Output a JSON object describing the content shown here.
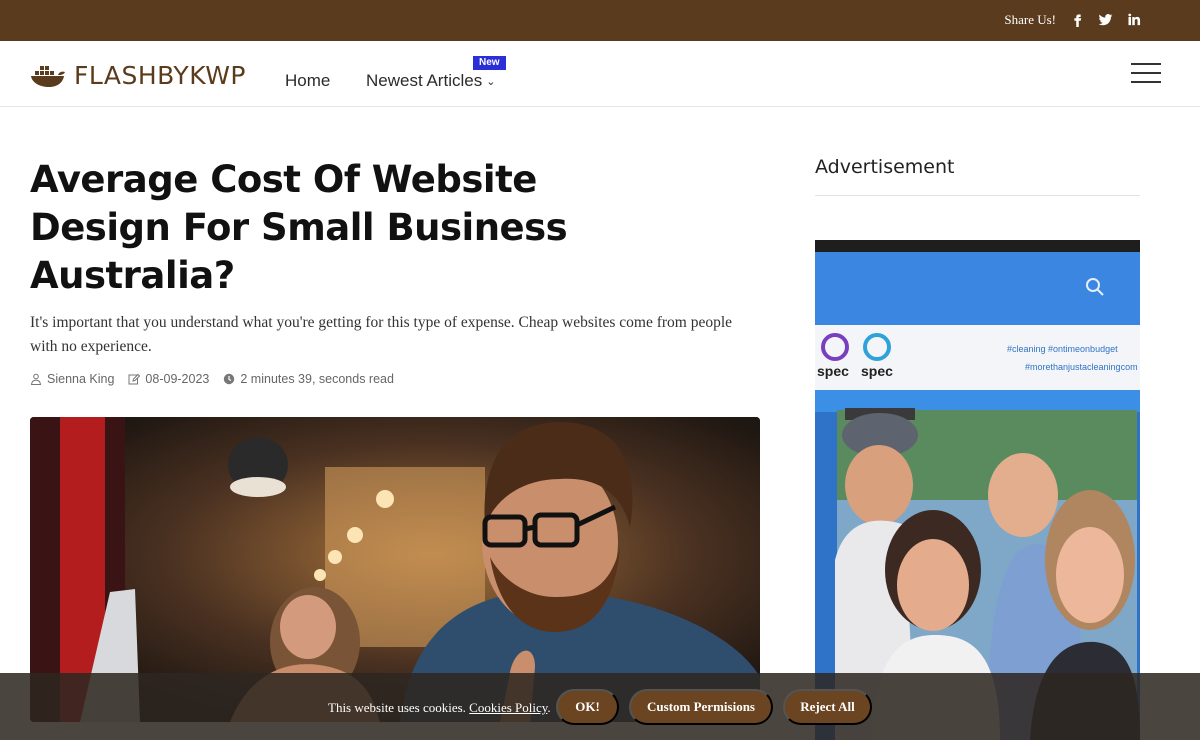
{
  "topbar": {
    "share_label": "Share Us!",
    "social_icons": [
      "facebook-icon",
      "twitter-icon",
      "linkedin-icon"
    ]
  },
  "header": {
    "logo_text": "FLASHBYKWP",
    "nav": {
      "home": "Home",
      "newest": "Newest Articles",
      "newest_badge": "New"
    }
  },
  "article": {
    "title": "Average Cost Of Website Design For Small Business Australia?",
    "subtitle": "It's important that you understand what you're getting for this type of expense. Cheap websites come from people with no experience.",
    "author": "Sienna King",
    "date": "08-09-2023",
    "read_time": "2 minutes 39, seconds read"
  },
  "sidebar": {
    "heading": "Advertisement",
    "ad_image_text": {
      "brand_1": "spec",
      "brand_2": "spec",
      "hashtags_1": "#cleaning  #ontimeonbudget",
      "hashtags_2": "#morethanjustacleaningcom"
    }
  },
  "cookie_bar": {
    "text": "This website uses cookies.",
    "link": "Cookies Policy",
    "suffix": ".",
    "ok": "OK!",
    "custom": "Custom Permisions",
    "reject": "Reject All"
  },
  "colors": {
    "brand_brown": "#5b3b1d",
    "button_brown": "#6b4421",
    "badge_blue": "#2b2fd6"
  }
}
